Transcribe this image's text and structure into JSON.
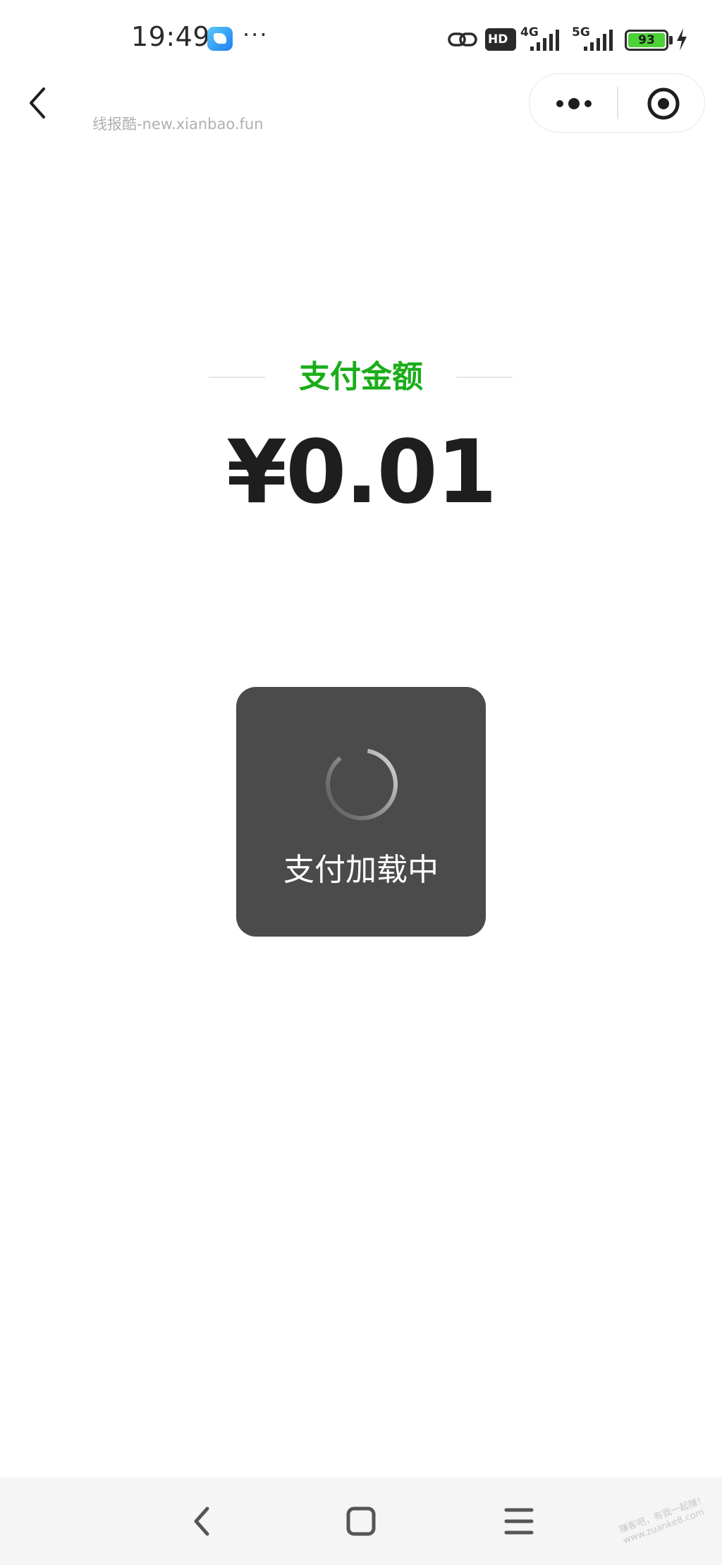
{
  "status_bar": {
    "time": "19:49",
    "more": "···",
    "hd_badge": "HD",
    "net_4g": "4G",
    "net_5g": "5G",
    "battery_level": "93",
    "icons": [
      "link-icon",
      "signal-icon",
      "charging-icon"
    ]
  },
  "nav": {
    "source_watermark": "线报酷-new.xianbao.fun",
    "back_icon": "chevron-left-icon",
    "more_icon": "more-dots-icon",
    "close_icon": "target-icon"
  },
  "payment": {
    "title": "支付金额",
    "amount": "¥0.01",
    "title_color": "#1aad19"
  },
  "loading": {
    "text": "支付加载中",
    "icon": "spinner-icon"
  },
  "bottom_nav": {
    "icons": [
      "back-icon",
      "home-icon",
      "menu-icon"
    ],
    "corner_watermark_line1": "赚客吧，有我一起赚！",
    "corner_watermark_line2": "www.zuanke8.com"
  }
}
